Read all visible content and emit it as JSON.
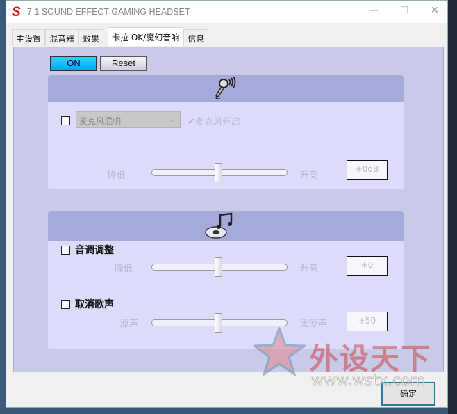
{
  "window": {
    "title": "7.1 SOUND EFFECT GAMING HEADSET",
    "logo": "S",
    "minimize": "—",
    "maximize": "☐",
    "close": "✕"
  },
  "tabs": [
    {
      "label": "主设置"
    },
    {
      "label": "混音器"
    },
    {
      "label": "效果"
    },
    {
      "label": "卡拉 OK/魔幻音响",
      "active": true
    },
    {
      "label": "信息"
    }
  ],
  "toolbar": {
    "on_label": "ON",
    "reset_label": "Reset"
  },
  "mic_group": {
    "icon": "microphone-icon",
    "dropdown_value": "麦克风混响",
    "dropdown_chevron": "⌄",
    "mic_on_label": "✔麦克风开启",
    "slider_low": "降低",
    "slider_high": "升高",
    "value": "+0dB",
    "slider_fraction": 0.5
  },
  "music_group": {
    "icon": "music-disc-icon",
    "pitch": {
      "label": "音调调整",
      "low": "降低",
      "high": "升高",
      "value": "+0",
      "slider_fraction": 0.5
    },
    "vocal": {
      "label": "取消歌声",
      "low": "原声",
      "high": "无原声",
      "value": "+50",
      "slider_fraction": 0.5
    }
  },
  "ok_label": "确定",
  "watermark": {
    "brand": "外设天下",
    "url": "www.wstx.com"
  }
}
